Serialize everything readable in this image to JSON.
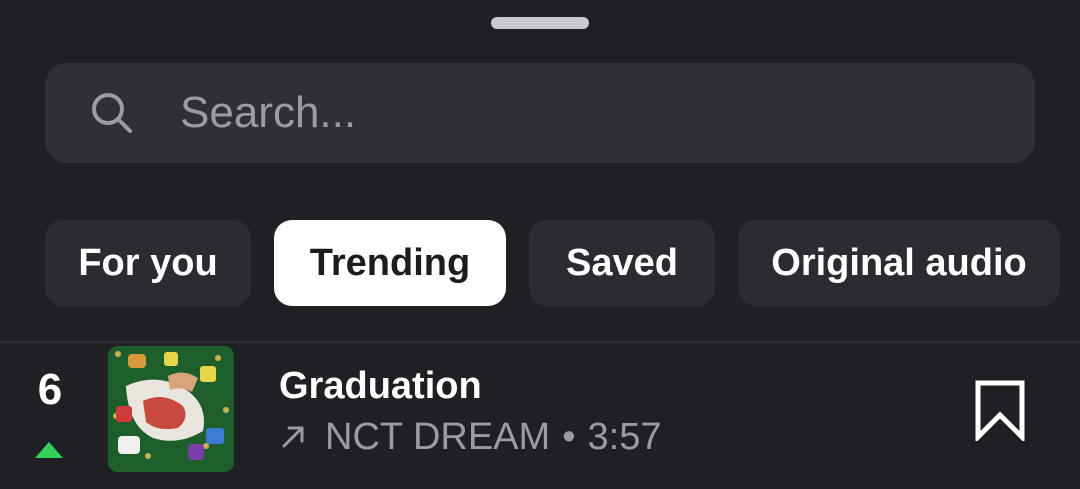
{
  "sheet": {
    "handle": "drag-handle"
  },
  "search": {
    "placeholder": "Search...",
    "icon": "search-icon"
  },
  "tabs": [
    {
      "label": "For you",
      "active": false
    },
    {
      "label": "Trending",
      "active": true
    },
    {
      "label": "Saved",
      "active": false
    },
    {
      "label": "Original audio",
      "active": false
    }
  ],
  "track": {
    "rank": "6",
    "trend": "up",
    "title": "Graduation",
    "artist": "NCT DREAM",
    "separator": "•",
    "duration": "3:57",
    "artist_icon": "arrow-up-right-icon",
    "action_icon": "bookmark-icon"
  },
  "colors": {
    "background": "#1f2024",
    "surface": "#2e3036",
    "tab_bg": "#2a2c31",
    "active_tab_bg": "#ffffff",
    "trend_up": "#2fd15a",
    "muted_text": "#9a9ca1"
  }
}
